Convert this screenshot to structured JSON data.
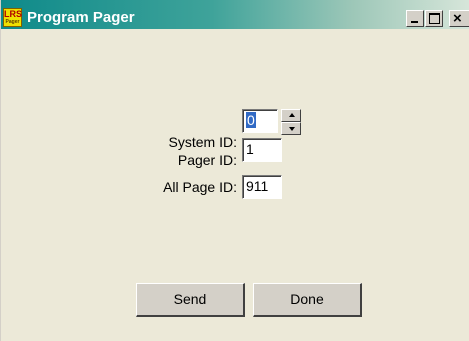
{
  "window": {
    "title": "Program Pager",
    "icon": {
      "name": "lrs-pager-app-icon",
      "line1": "LRS",
      "line2": "Pager"
    },
    "controls": {
      "minimize": "minimize-icon",
      "maximize": "maximize-icon",
      "close": "close-icon",
      "close_glyph": "×"
    }
  },
  "form": {
    "system_id": {
      "label": "System ID:",
      "value": "0"
    },
    "pager_id": {
      "label": "Pager ID:",
      "value": "1"
    },
    "all_page_id": {
      "label": "All Page ID:",
      "value": "911"
    }
  },
  "buttons": {
    "send": "Send",
    "done": "Done"
  },
  "colors": {
    "face": "#ece9d8",
    "titlebar_start": "#0e8a8a",
    "selection": "#316ac5"
  }
}
